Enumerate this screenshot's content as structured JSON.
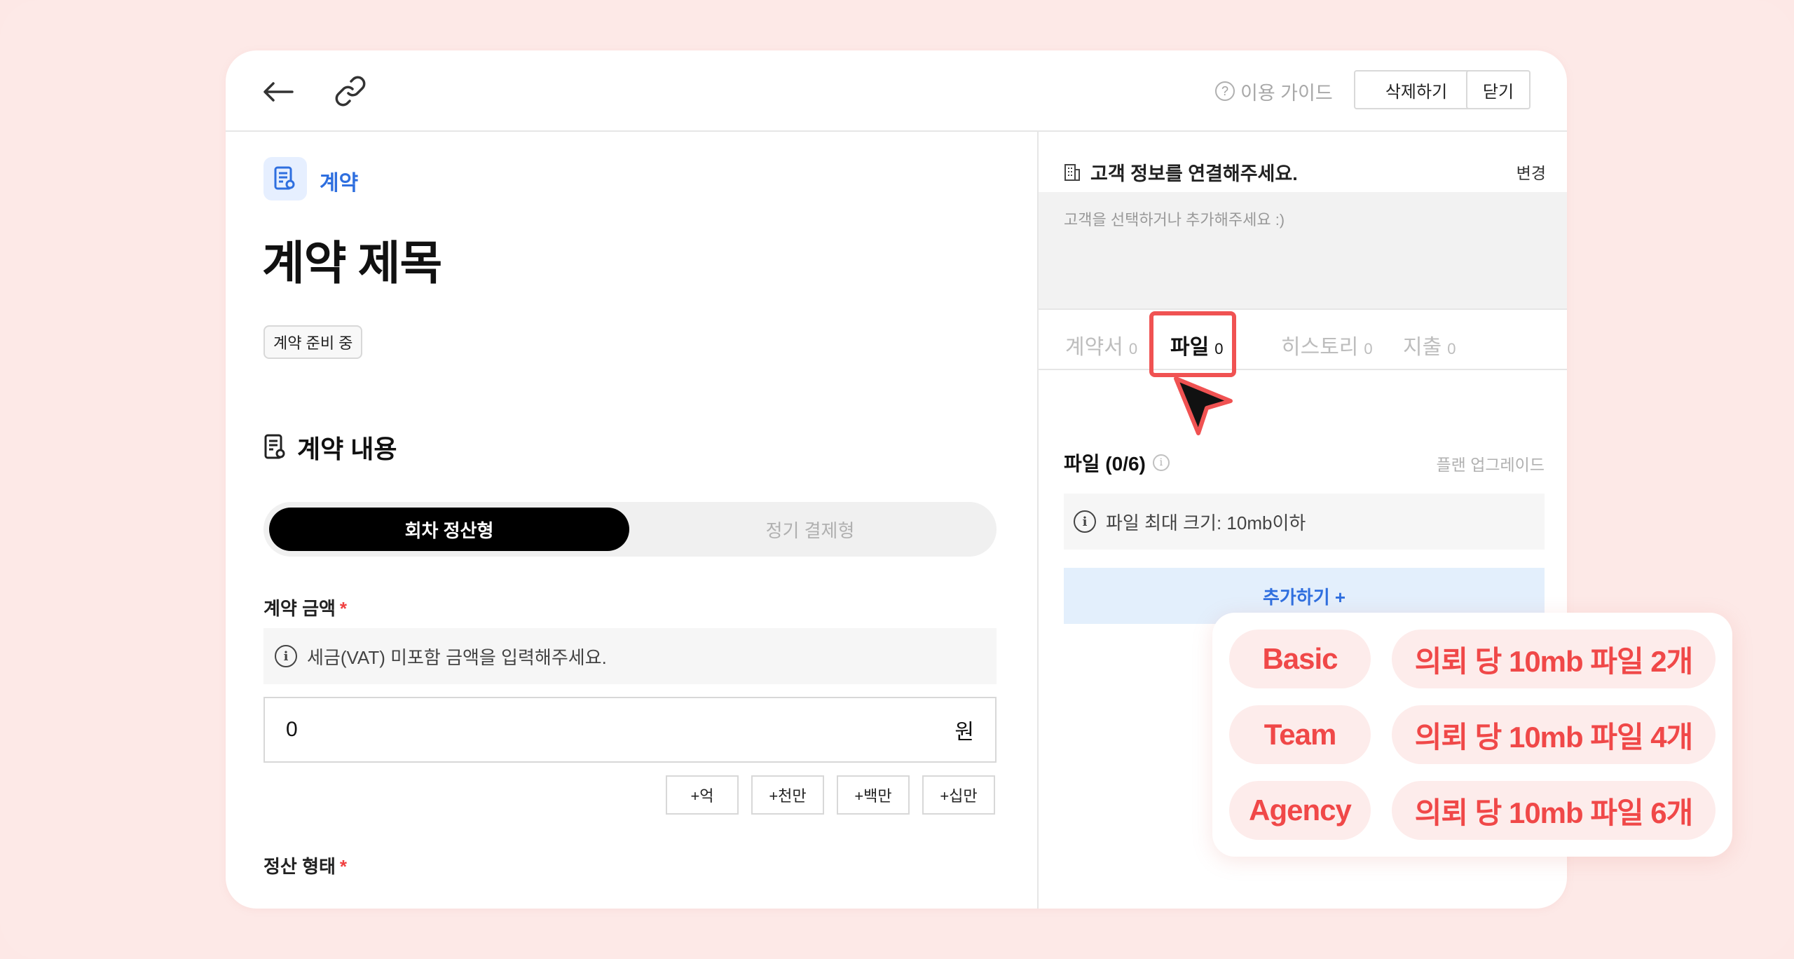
{
  "toolbar": {
    "guide_label": "이용 가이드",
    "delete_label": "삭제하기",
    "close_label": "닫기"
  },
  "contract": {
    "category": "계약",
    "title": "계약 제목",
    "status": "계약 준비 중",
    "section_title": "계약 내용",
    "toggle_options": [
      "회차 정산형",
      "정기 결제형"
    ],
    "amount_label": "계약 금액",
    "amount_info": "세금(VAT) 미포함 금액을 입력해주세요.",
    "amount_value": "0",
    "amount_unit": "원",
    "quick_add": [
      "+억",
      "+천만",
      "+백만",
      "+십만"
    ],
    "settle_label": "정산 형태",
    "required_mark": "*"
  },
  "customer": {
    "header": "고객 정보를 연결해주세요.",
    "change_label": "변경",
    "placeholder": "고객을 선택하거나 추가해주세요 :)"
  },
  "tabs": [
    {
      "label": "계약서",
      "count": "0"
    },
    {
      "label": "파일",
      "count": "0"
    },
    {
      "label": "히스토리",
      "count": "0"
    },
    {
      "label": "지출",
      "count": "0"
    }
  ],
  "files": {
    "title": "파일 (0/6)",
    "upgrade_label": "플랜 업그레이드",
    "info": "파일 최대 크기: 10mb이하",
    "add_label": "추가하기 +"
  },
  "plans": [
    {
      "name": "Basic",
      "desc": "의뢰 당 10mb 파일 2개"
    },
    {
      "name": "Team",
      "desc": "의뢰 당 10mb 파일 4개"
    },
    {
      "name": "Agency",
      "desc": "의뢰 당 10mb 파일 6개"
    }
  ],
  "colors": {
    "accent_blue": "#2f6fdf",
    "highlight_red": "#f05252",
    "background_pink": "#fde9e7"
  }
}
